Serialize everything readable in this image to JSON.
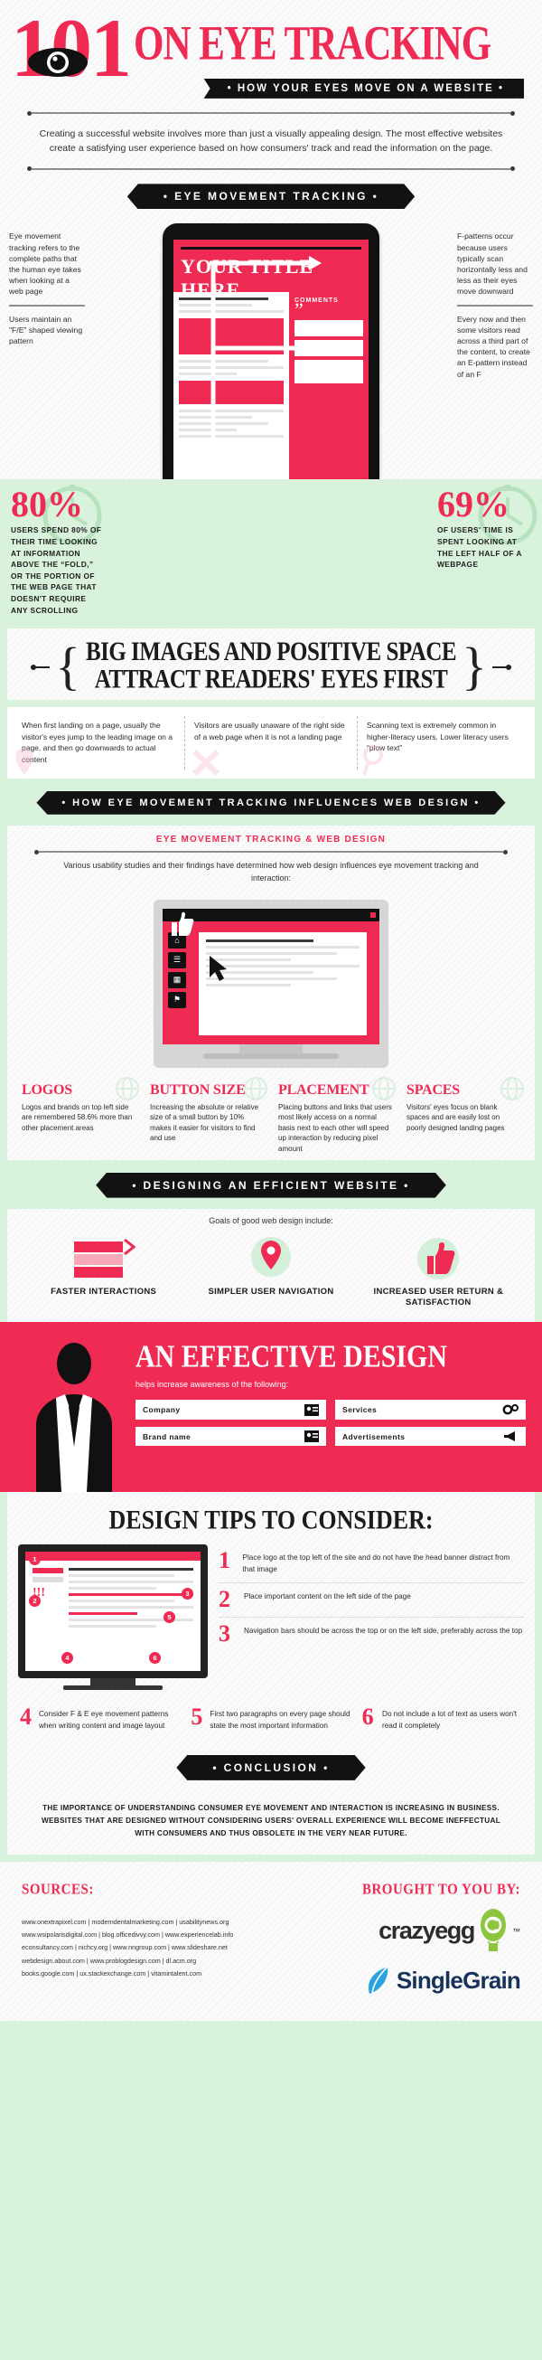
{
  "header": {
    "number": "101",
    "title": "ON EYE TRACKING",
    "ribbon": "• HOW YOUR EYES MOVE ON A WEBSITE •",
    "eye_icon": "eye-icon"
  },
  "intro": "Creating a successful website involves more than just a visually appealing design. The most effective websites create a satisfying user experience based on how consumers' track and read the information on the page.",
  "eye_movement": {
    "banner": "• EYE MOVEMENT TRACKING •",
    "left_notes": [
      "Eye movement tracking refers to the complete paths that the human eye takes when looking at a web page",
      "Users maintain an \"F/E\" shaped viewing pattern"
    ],
    "right_notes": [
      "F-patterns occur because users typically scan horizontally less and less as their eyes move downward",
      "Every now and then some visitors read across a third part of the content, to create an E-pattern instead of an F"
    ],
    "stat_left": {
      "number": "80%",
      "text": "USERS SPEND 80% OF THEIR TIME LOOKING AT INFORMATION ABOVE THE “FOLD,” OR THE PORTION OF THE WEB PAGE THAT DOESN'T REQUIRE ANY SCROLLING"
    },
    "stat_right": {
      "number": "69%",
      "text": "OF USERS' TIME IS SPENT LOOKING AT THE LEFT HALF OF A WEBPAGE"
    },
    "tablet": {
      "headline": "YOUR TITLE HERE",
      "sidebar_label": "COMMENTS",
      "quote_mark": "”"
    }
  },
  "big_images": {
    "title_line1": "BIG IMAGES AND POSITIVE SPACE",
    "title_line2": "ATTRACT READERS' EYES FIRST",
    "notes": [
      "When first landing on a page, usually the visitor's eyes jump to the leading image on a page, and then go downwards to actual content",
      "Visitors are usually unaware of the right side of a web page when it is not a landing page",
      "Scanning text is extremely common in higher-literacy users. Lower literacy users “plow text”"
    ]
  },
  "web_design": {
    "banner": "• HOW EYE MOVEMENT TRACKING INFLUENCES WEB DESIGN •",
    "subtitle": "EYE MOVEMENT TRACKING & WEB DESIGN",
    "description": "Various usability studies and their findings have determined how web design influences eye movement tracking and interaction:",
    "columns": [
      {
        "title": "LOGOS",
        "text": "Logos and brands on top left side are remembered 58.6% more than other placement areas"
      },
      {
        "title": "BUTTON SIZE",
        "text": "Increasing the absolute or relative size of a small button by 10% makes it easier for visitors to find and use"
      },
      {
        "title": "PLACEMENT",
        "text": "Placing buttons and links that users most likely access on a normal basis next to each other will speed up interaction by reducing pixel amount"
      },
      {
        "title": "SPACES",
        "text": "Visitors' eyes focus on blank spaces and are easily lost on poorly designed landing pages"
      }
    ]
  },
  "efficient": {
    "banner": "• DESIGNING AN EFFICIENT WEBSITE •",
    "goals_intro": "Goals of good web design include:",
    "goals": [
      {
        "icon": "cards-icon",
        "label": "FASTER INTERACTIONS"
      },
      {
        "icon": "map-pin-icon",
        "label": "SIMPLER USER NAVIGATION"
      },
      {
        "icon": "thumbs-up-icon",
        "label": "INCREASED USER RETURN & SATISFACTION"
      }
    ]
  },
  "effective_design": {
    "title": "AN EFFECTIVE DESIGN",
    "subtitle": "helps increase awareness of the following:",
    "chips": [
      {
        "label": "Company",
        "icon": "id-card-icon"
      },
      {
        "label": "Services",
        "icon": "gears-icon"
      },
      {
        "label": "Brand name",
        "icon": "contact-icon"
      },
      {
        "label": "Advertisements",
        "icon": "megaphone-icon"
      }
    ]
  },
  "design_tips": {
    "title": "DESIGN TIPS TO CONSIDER:",
    "monitor_markers": [
      "1",
      "2",
      "3",
      "4",
      "5",
      "6"
    ],
    "monitor_exclaim": "!!!",
    "tips": [
      {
        "n": "1",
        "text": "Place logo at the top left of the site and do not have the head banner distract from that image"
      },
      {
        "n": "2",
        "text": "Place important content on the left side of the page"
      },
      {
        "n": "3",
        "text": "Navigation bars should be across the top or on the left side, preferably across the top"
      },
      {
        "n": "4",
        "text": "Consider F & E eye movement patterns when writing content and image layout"
      },
      {
        "n": "5",
        "text": "First two paragraphs on every page should state the most important information"
      },
      {
        "n": "6",
        "text": "Do not include a lot of text as users won't read it completely"
      }
    ]
  },
  "conclusion": {
    "banner": "• CONCLUSION •",
    "text": "THE IMPORTANCE OF UNDERSTANDING CONSUMER EYE MOVEMENT AND INTERACTION IS INCREASING IN BUSINESS. WEBSITES THAT ARE DESIGNED WITHOUT CONSIDERING USERS' OVERALL EXPERIENCE WILL BECOME INEFFECTUAL WITH CONSUMERS AND THUS OBSOLETE IN THE VERY NEAR FUTURE."
  },
  "footer": {
    "sources_heading": "SOURCES:",
    "sources": [
      "www.onextrapixel.com | moderndentalmarketing.com | usabilitynews.org",
      "www.wsipolarisdigital.com | blog.officedivvy.com | www.experiencelab.info",
      "econsultancy.com | nichcy.org |  www.nngroup.com | www.slideshare.net",
      "webdesign.about.com |  www.problogdesign.com | dl.acm.org",
      "books.google.com | ux.stackexchange.com | vitamintalent.com"
    ],
    "brought_by": "BROUGHT TO YOU BY:",
    "brand1": "crazyegg",
    "brand1_tm": "™",
    "brand2": "SingleGrain"
  },
  "colors": {
    "red": "#ef2a53",
    "black": "#121212",
    "mint": "#d9f2dc",
    "navy": "#17335c",
    "green_logo": "#8cc63e"
  }
}
